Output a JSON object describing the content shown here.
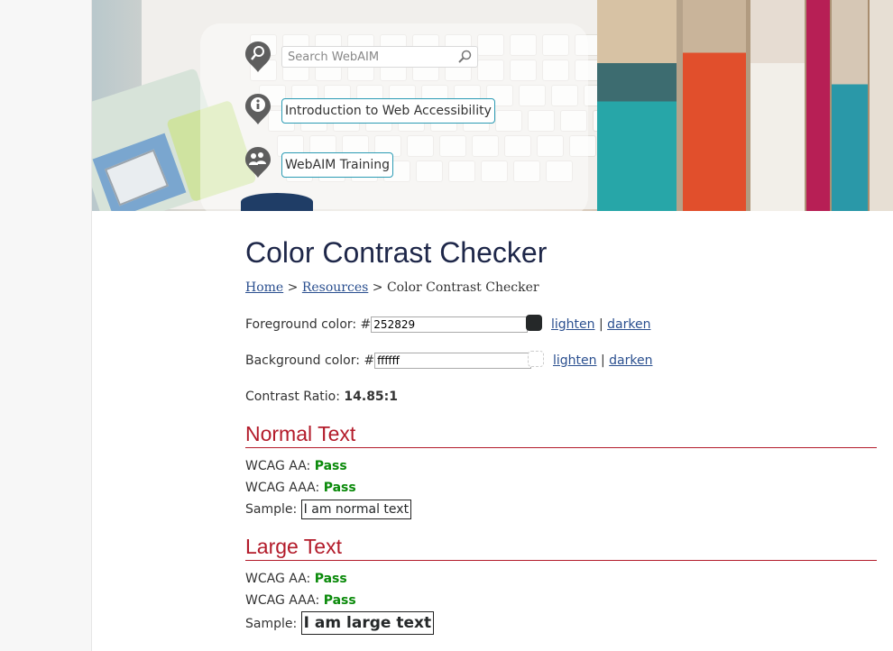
{
  "header": {
    "search_placeholder": "Search WebAIM",
    "nav": [
      {
        "label": "Introduction to Web Accessibility"
      },
      {
        "label": "WebAIM Training"
      }
    ]
  },
  "main": {
    "title": "Color Contrast Checker",
    "breadcrumb": {
      "home": "Home",
      "resources": "Resources",
      "sep": ">",
      "current": "Color Contrast Checker"
    },
    "foreground": {
      "label": "Foreground color: #",
      "value": "252829",
      "swatch_color": "#252829",
      "lighten": "lighten",
      "darken": "darken",
      "pipe": "|"
    },
    "background": {
      "label": "Background color: #",
      "value": "ffffff",
      "swatch_color": "#ffffff",
      "lighten": "lighten",
      "darken": "darken",
      "pipe": "|"
    },
    "contrast": {
      "label": "Contrast Ratio: ",
      "value": "14.85:1"
    },
    "normal_text": {
      "heading": "Normal Text",
      "aa_label": "WCAG AA: ",
      "aa_value": "Pass",
      "aaa_label": "WCAG AAA: ",
      "aaa_value": "Pass",
      "sample_label": "Sample: ",
      "sample_text": "I am normal text"
    },
    "large_text": {
      "heading": "Large Text",
      "aa_label": "WCAG AA: ",
      "aa_value": "Pass",
      "aaa_label": "WCAG AAA: ",
      "aaa_value": "Pass",
      "sample_label": "Sample: ",
      "sample_text": "I am large text"
    }
  },
  "colors": {
    "heading": "#1e2749",
    "section": "#b31b2a",
    "pass": "#0a8a0a",
    "link": "#2a4f8f",
    "nav_border": "#2b9bb4"
  },
  "icons": [
    "search-icon",
    "info-icon",
    "training-icon",
    "magnifier-icon"
  ]
}
